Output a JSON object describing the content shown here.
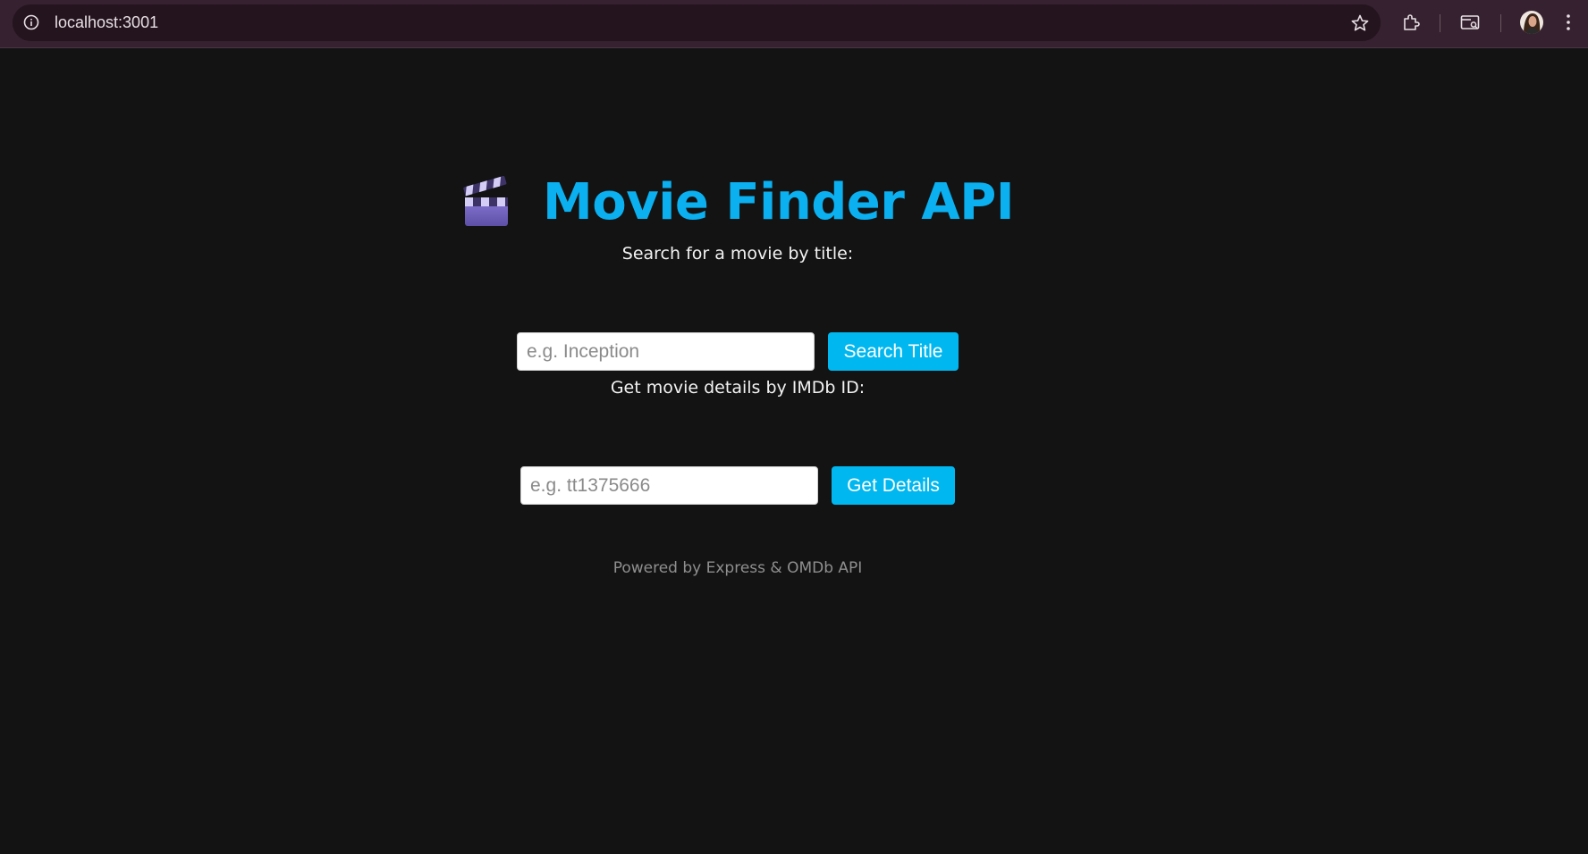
{
  "browser": {
    "url": "localhost:3001",
    "icons": [
      "info-icon",
      "star-icon",
      "extensions-icon",
      "tab-search-icon",
      "avatar",
      "kebab-menu-icon"
    ]
  },
  "header": {
    "emoji_icon": "clapper-board-icon",
    "title": "Movie Finder API"
  },
  "search_section": {
    "label": "Search for a movie by title:",
    "placeholder": "e.g. Inception",
    "value": "",
    "button_label": "Search Title"
  },
  "details_section": {
    "label": "Get movie details by IMDb ID:",
    "placeholder": "e.g. tt1375666",
    "value": "",
    "button_label": "Get Details"
  },
  "footer": {
    "text": "Powered by Express & OMDb API"
  },
  "colors": {
    "background": "#131313",
    "accent": "#00b7ef",
    "title": "#0bb0f0",
    "browser_bar": "#35212f"
  }
}
